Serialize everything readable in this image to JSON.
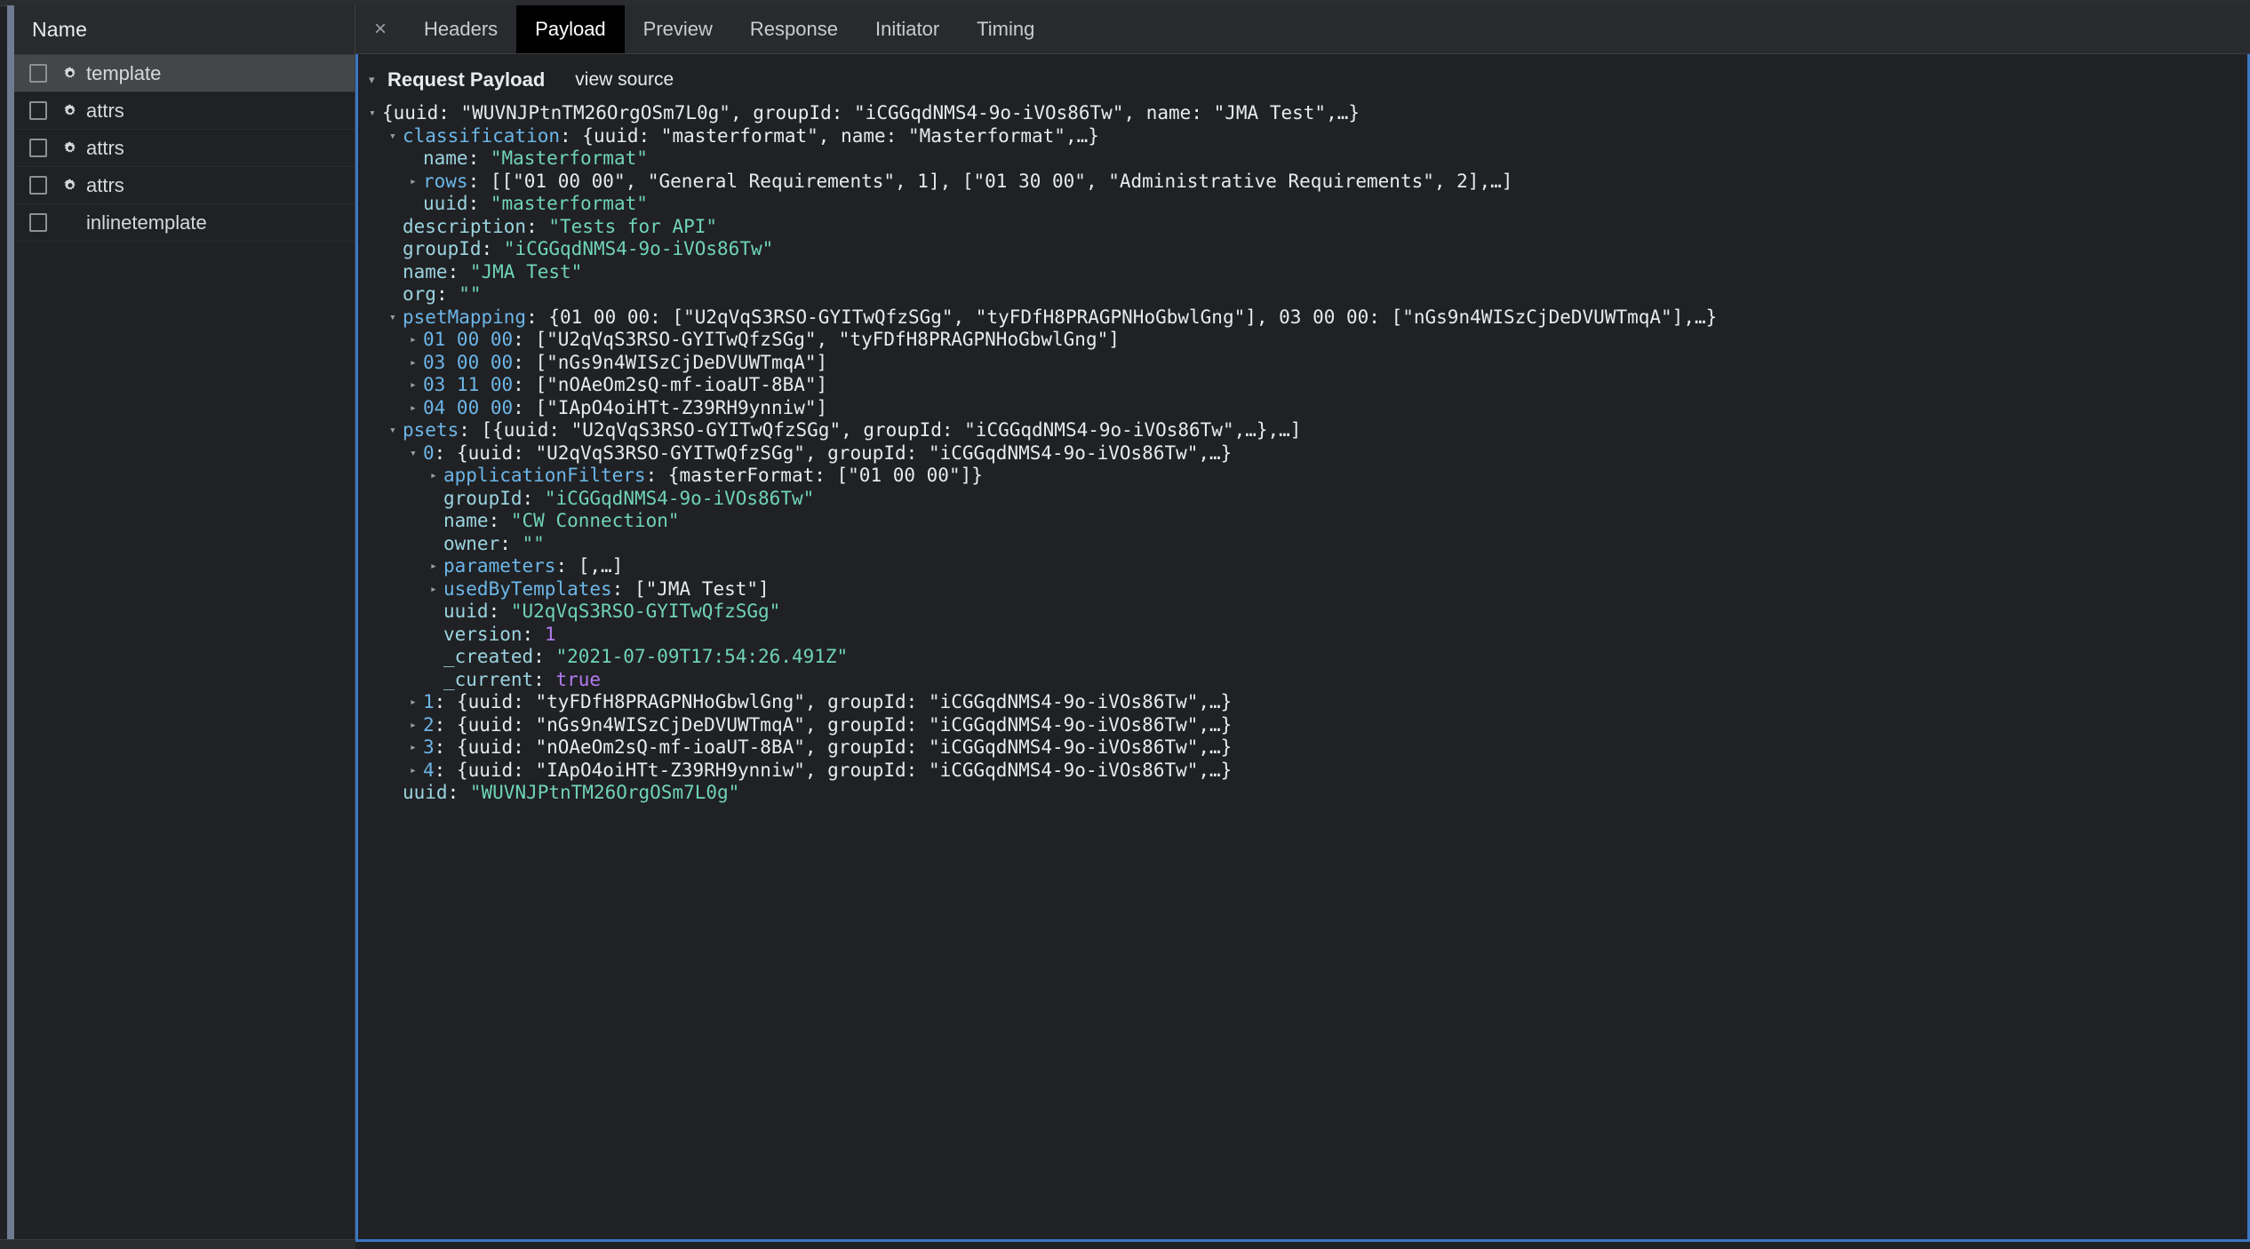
{
  "window": {
    "accent_selected_tab_bg": "#000000",
    "panel_border_color": "#3b77c4",
    "background": "#202124"
  },
  "request_pane": {
    "column_header": "Name",
    "rows": [
      {
        "name": "template",
        "icon": "gear-icon",
        "selected": true,
        "checked": false
      },
      {
        "name": "attrs",
        "icon": "gear-icon",
        "selected": false,
        "checked": false
      },
      {
        "name": "attrs",
        "icon": "gear-icon",
        "selected": false,
        "checked": false
      },
      {
        "name": "attrs",
        "icon": "gear-icon",
        "selected": false,
        "checked": false
      },
      {
        "name": "inlinetemplate",
        "icon": "",
        "selected": false,
        "checked": false
      }
    ]
  },
  "tabs": {
    "close_label": "×",
    "items": [
      {
        "label": "Headers",
        "active": false
      },
      {
        "label": "Payload",
        "active": true
      },
      {
        "label": "Preview",
        "active": false
      },
      {
        "label": "Response",
        "active": false
      },
      {
        "label": "Initiator",
        "active": false
      },
      {
        "label": "Timing",
        "active": false
      }
    ]
  },
  "payload": {
    "section_title": "Request Payload",
    "view_source_label": "view source",
    "tree": [
      {
        "indent": 0,
        "arrow": "open",
        "segments": [
          {
            "t": "{uuid: ",
            "c": "punct"
          },
          {
            "t": "\"WUVNJPtnTM26OrgOSm7L0g\"",
            "c": "punct"
          },
          {
            "t": ", groupId: ",
            "c": "punct"
          },
          {
            "t": "\"iCGGqdNMS4-9o-iVOs86Tw\"",
            "c": "punct"
          },
          {
            "t": ", name: ",
            "c": "punct"
          },
          {
            "t": "\"JMA Test\"",
            "c": "punct"
          },
          {
            "t": ",…}",
            "c": "punct"
          }
        ]
      },
      {
        "indent": 1,
        "arrow": "open",
        "segments": [
          {
            "t": "classification",
            "c": "k-exp"
          },
          {
            "t": ": {uuid: \"masterformat\", name: \"Masterformat\",…}",
            "c": "punct"
          }
        ]
      },
      {
        "indent": 2,
        "arrow": "none",
        "segments": [
          {
            "t": "name",
            "c": "k-plain"
          },
          {
            "t": ": ",
            "c": "punct"
          },
          {
            "t": "\"Masterformat\"",
            "c": "s-val"
          }
        ]
      },
      {
        "indent": 2,
        "arrow": "closed",
        "segments": [
          {
            "t": "rows",
            "c": "k-exp"
          },
          {
            "t": ": [[\"01 00 00\", \"General Requirements\", 1], [\"01 30 00\", \"Administrative Requirements\", 2],…]",
            "c": "punct"
          }
        ]
      },
      {
        "indent": 2,
        "arrow": "none",
        "segments": [
          {
            "t": "uuid",
            "c": "k-plain"
          },
          {
            "t": ": ",
            "c": "punct"
          },
          {
            "t": "\"masterformat\"",
            "c": "s-val"
          }
        ]
      },
      {
        "indent": 1,
        "arrow": "none",
        "segments": [
          {
            "t": "description",
            "c": "k-plain"
          },
          {
            "t": ": ",
            "c": "punct"
          },
          {
            "t": "\"Tests for API\"",
            "c": "s-val"
          }
        ]
      },
      {
        "indent": 1,
        "arrow": "none",
        "segments": [
          {
            "t": "groupId",
            "c": "k-plain"
          },
          {
            "t": ": ",
            "c": "punct"
          },
          {
            "t": "\"iCGGqdNMS4-9o-iVOs86Tw\"",
            "c": "s-val"
          }
        ]
      },
      {
        "indent": 1,
        "arrow": "none",
        "segments": [
          {
            "t": "name",
            "c": "k-plain"
          },
          {
            "t": ": ",
            "c": "punct"
          },
          {
            "t": "\"JMA Test\"",
            "c": "s-val"
          }
        ]
      },
      {
        "indent": 1,
        "arrow": "none",
        "segments": [
          {
            "t": "org",
            "c": "k-plain"
          },
          {
            "t": ": ",
            "c": "punct"
          },
          {
            "t": "\"\"",
            "c": "s-val"
          }
        ]
      },
      {
        "indent": 1,
        "arrow": "open",
        "segments": [
          {
            "t": "psetMapping",
            "c": "k-exp"
          },
          {
            "t": ": {01 00 00: [\"U2qVqS3RSO-GYITwQfzSGg\", \"tyFDfH8PRAGPNHoGbwlGng\"], 03 00 00: [\"nGs9n4WISzCjDeDVUWTmqA\"],…}",
            "c": "punct"
          }
        ]
      },
      {
        "indent": 2,
        "arrow": "closed",
        "segments": [
          {
            "t": "01 00 00",
            "c": "k-exp"
          },
          {
            "t": ": [\"U2qVqS3RSO-GYITwQfzSGg\", \"tyFDfH8PRAGPNHoGbwlGng\"]",
            "c": "punct"
          }
        ]
      },
      {
        "indent": 2,
        "arrow": "closed",
        "segments": [
          {
            "t": "03 00 00",
            "c": "k-exp"
          },
          {
            "t": ": [\"nGs9n4WISzCjDeDVUWTmqA\"]",
            "c": "punct"
          }
        ]
      },
      {
        "indent": 2,
        "arrow": "closed",
        "segments": [
          {
            "t": "03 11 00",
            "c": "k-exp"
          },
          {
            "t": ": [\"nOAeOm2sQ-mf-ioaUT-8BA\"]",
            "c": "punct"
          }
        ]
      },
      {
        "indent": 2,
        "arrow": "closed",
        "segments": [
          {
            "t": "04 00 00",
            "c": "k-exp"
          },
          {
            "t": ": [\"IApO4oiHTt-Z39RH9ynniw\"]",
            "c": "punct"
          }
        ]
      },
      {
        "indent": 1,
        "arrow": "open",
        "segments": [
          {
            "t": "psets",
            "c": "k-exp"
          },
          {
            "t": ": [{uuid: \"U2qVqS3RSO-GYITwQfzSGg\", groupId: \"iCGGqdNMS4-9o-iVOs86Tw\",…},…]",
            "c": "punct"
          }
        ]
      },
      {
        "indent": 2,
        "arrow": "open",
        "segments": [
          {
            "t": "0",
            "c": "k-exp"
          },
          {
            "t": ": {uuid: \"U2qVqS3RSO-GYITwQfzSGg\", groupId: \"iCGGqdNMS4-9o-iVOs86Tw\",…}",
            "c": "punct"
          }
        ]
      },
      {
        "indent": 3,
        "arrow": "closed",
        "segments": [
          {
            "t": "applicationFilters",
            "c": "k-exp"
          },
          {
            "t": ": {masterFormat: [\"01 00 00\"]}",
            "c": "punct"
          }
        ]
      },
      {
        "indent": 3,
        "arrow": "none",
        "segments": [
          {
            "t": "groupId",
            "c": "k-plain"
          },
          {
            "t": ": ",
            "c": "punct"
          },
          {
            "t": "\"iCGGqdNMS4-9o-iVOs86Tw\"",
            "c": "s-val"
          }
        ]
      },
      {
        "indent": 3,
        "arrow": "none",
        "segments": [
          {
            "t": "name",
            "c": "k-plain"
          },
          {
            "t": ": ",
            "c": "punct"
          },
          {
            "t": "\"CW Connection\"",
            "c": "s-val"
          }
        ]
      },
      {
        "indent": 3,
        "arrow": "none",
        "segments": [
          {
            "t": "owner",
            "c": "k-plain"
          },
          {
            "t": ": ",
            "c": "punct"
          },
          {
            "t": "\"\"",
            "c": "s-val"
          }
        ]
      },
      {
        "indent": 3,
        "arrow": "closed",
        "segments": [
          {
            "t": "parameters",
            "c": "k-exp"
          },
          {
            "t": ": [,…]",
            "c": "punct"
          }
        ]
      },
      {
        "indent": 3,
        "arrow": "closed",
        "segments": [
          {
            "t": "usedByTemplates",
            "c": "k-exp"
          },
          {
            "t": ": [\"JMA Test\"]",
            "c": "punct"
          }
        ]
      },
      {
        "indent": 3,
        "arrow": "none",
        "segments": [
          {
            "t": "uuid",
            "c": "k-plain"
          },
          {
            "t": ": ",
            "c": "punct"
          },
          {
            "t": "\"U2qVqS3RSO-GYITwQfzSGg\"",
            "c": "s-val"
          }
        ]
      },
      {
        "indent": 3,
        "arrow": "none",
        "segments": [
          {
            "t": "version",
            "c": "k-plain"
          },
          {
            "t": ": ",
            "c": "punct"
          },
          {
            "t": "1",
            "c": "num"
          }
        ]
      },
      {
        "indent": 3,
        "arrow": "none",
        "segments": [
          {
            "t": "_created",
            "c": "k-plain"
          },
          {
            "t": ": ",
            "c": "punct"
          },
          {
            "t": "\"2021-07-09T17:54:26.491Z\"",
            "c": "s-val"
          }
        ]
      },
      {
        "indent": 3,
        "arrow": "none",
        "segments": [
          {
            "t": "_current",
            "c": "k-plain"
          },
          {
            "t": ": ",
            "c": "punct"
          },
          {
            "t": "true",
            "c": "bool"
          }
        ]
      },
      {
        "indent": 2,
        "arrow": "closed",
        "segments": [
          {
            "t": "1",
            "c": "k-exp"
          },
          {
            "t": ": {uuid: \"tyFDfH8PRAGPNHoGbwlGng\", groupId: \"iCGGqdNMS4-9o-iVOs86Tw\",…}",
            "c": "punct"
          }
        ]
      },
      {
        "indent": 2,
        "arrow": "closed",
        "segments": [
          {
            "t": "2",
            "c": "k-exp"
          },
          {
            "t": ": {uuid: \"nGs9n4WISzCjDeDVUWTmqA\", groupId: \"iCGGqdNMS4-9o-iVOs86Tw\",…}",
            "c": "punct"
          }
        ]
      },
      {
        "indent": 2,
        "arrow": "closed",
        "segments": [
          {
            "t": "3",
            "c": "k-exp"
          },
          {
            "t": ": {uuid: \"nOAeOm2sQ-mf-ioaUT-8BA\", groupId: \"iCGGqdNMS4-9o-iVOs86Tw\",…}",
            "c": "punct"
          }
        ]
      },
      {
        "indent": 2,
        "arrow": "closed",
        "segments": [
          {
            "t": "4",
            "c": "k-exp"
          },
          {
            "t": ": {uuid: \"IApO4oiHTt-Z39RH9ynniw\", groupId: \"iCGGqdNMS4-9o-iVOs86Tw\",…}",
            "c": "punct"
          }
        ]
      },
      {
        "indent": 1,
        "arrow": "none",
        "segments": [
          {
            "t": "uuid",
            "c": "k-plain"
          },
          {
            "t": ": ",
            "c": "punct"
          },
          {
            "t": "\"WUVNJPtnTM26OrgOSm7L0g\"",
            "c": "s-val"
          }
        ]
      }
    ]
  }
}
